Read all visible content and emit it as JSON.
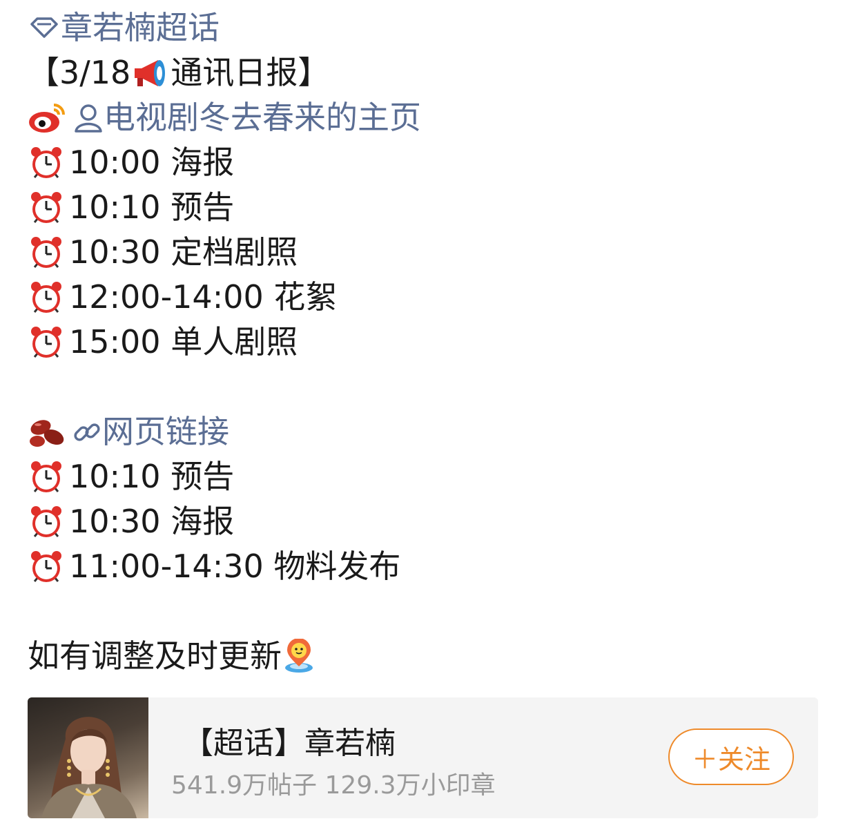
{
  "post": {
    "topic_link": "章若楠超话",
    "header": "【3/18",
    "header_tail": "通讯日报】",
    "weibo_link": "电视剧冬去春来的主页",
    "weibo_schedule": [
      {
        "time": "10:00",
        "item": "海报"
      },
      {
        "time": "10:10",
        "item": "预告"
      },
      {
        "time": "10:30",
        "item": "定档剧照"
      },
      {
        "time": "12:00-14:00",
        "item": "花絮"
      },
      {
        "time": "15:00",
        "item": "单人剧照"
      }
    ],
    "web_link": "网页链接",
    "web_schedule": [
      {
        "time": "10:10",
        "item": "预告"
      },
      {
        "time": "10:30",
        "item": "海报"
      },
      {
        "time": "11:00-14:30",
        "item": "物料发布"
      }
    ],
    "footer": "如有调整及时更新"
  },
  "card": {
    "title": "【超话】章若楠",
    "stats": "541.9万帖子 129.3万小印章",
    "follow_label": "＋关注"
  },
  "colors": {
    "link": "#5b6e94",
    "accent": "#ee8a2a",
    "card_bg": "#f4f4f4"
  },
  "icons": [
    "diamond-icon",
    "megaphone-icon",
    "weibo-logo-icon",
    "person-icon",
    "alarm-clock-icon",
    "beans-icon",
    "link-icon",
    "location-pin-icon"
  ]
}
